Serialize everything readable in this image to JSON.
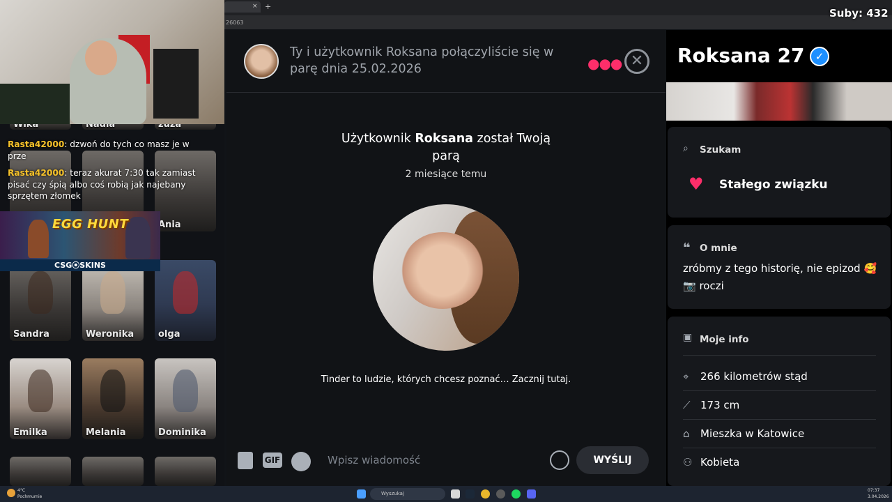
{
  "browser": {
    "url_fragment": "26063",
    "tab_new": "+",
    "tab_close": "×"
  },
  "overlay": {
    "subs": "Suby: 432"
  },
  "left": {
    "top_names": [
      "Wika",
      "Nadia",
      "zuza"
    ],
    "chat": [
      {
        "user": "Rasta42000",
        "text": ": dzwoń do tych co masz je w prze"
      },
      {
        "user": "Rasta42000",
        "text": ": teraz akurat 7:30 tak zamiast pisać czy śpią albo coś robią jak najebany sprzętem złomek"
      }
    ],
    "ad": {
      "title": "EGG HUNT",
      "sponsor": "CSG⦿SKINS"
    },
    "cards_row1_partial": [
      "Ania"
    ],
    "cards": [
      {
        "name": "Sandra"
      },
      {
        "name": "Weronika"
      },
      {
        "name": "olga"
      },
      {
        "name": "Emilka"
      },
      {
        "name": "Melania"
      },
      {
        "name": "Dominika"
      }
    ]
  },
  "chat": {
    "match_info": "Ty i użytkownik Roksana połączyliście się w parę dnia 25.02.2026",
    "match_pre": "Użytkownik ",
    "match_name": "Roksana",
    "match_post": " został Twoją parą",
    "time_ago": "2 miesiące temu",
    "tagline": "Tinder to ludzie, których chcesz poznać… Zacznij tutaj.",
    "input_placeholder": "Wpisz wiadomość",
    "send_label": "WYŚLIJ",
    "gif_label": "GIF"
  },
  "profile": {
    "name_age": "Roksana 27",
    "looking_for_label": "Szukam",
    "looking_for_value": "Stałego związku",
    "about_label": "O mnie",
    "about_text_1": "zróbmy z tego historię, nie epizod 🥰",
    "about_text_2": "📷 roczi",
    "info_label": "Moje info",
    "info": [
      {
        "icon": "location-icon",
        "text": "266 kilometrów stąd"
      },
      {
        "icon": "ruler-icon",
        "text": "173 cm"
      },
      {
        "icon": "home-icon",
        "text": "Mieszka w Katowice"
      },
      {
        "icon": "person-icon",
        "text": "Kobieta"
      }
    ]
  },
  "taskbar": {
    "weather_temp": "4°C",
    "weather_desc": "Pochmurnie",
    "search": "Wyszukaj",
    "time": "07:37",
    "date": "3.04.2026"
  },
  "colors": {
    "accent": "#fd2e6a",
    "verified": "#1e90ff",
    "chat_user": "#f6c22a"
  }
}
